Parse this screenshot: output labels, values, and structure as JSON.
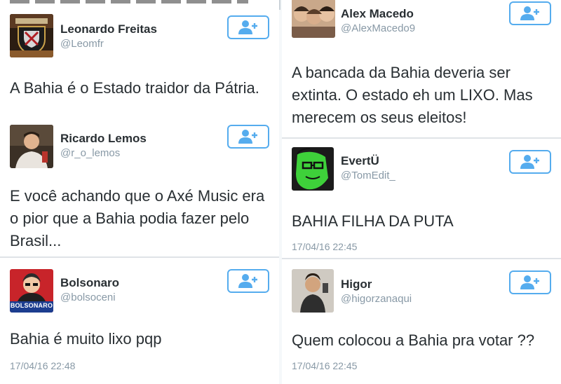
{
  "colors": {
    "accent": "#55acee",
    "text": "#292f33",
    "muted": "#8899a6",
    "divider": "#dfe3e7"
  },
  "icons": {
    "follow": "add-user-icon"
  },
  "left_column": {
    "tweets": [
      {
        "name": "Leonardo Freitas",
        "handle": "@Leomfr",
        "text": "A Bahia é o Estado traidor da Pátria.",
        "time": ""
      },
      {
        "name": "Ricardo Lemos",
        "handle": "@r_o_lemos",
        "text": "E você achando que o Axé Music era o pior que a Bahia podia fazer pelo Brasil...",
        "time": ""
      },
      {
        "name": "Bolsonaro",
        "handle": "@bolsoceni",
        "avatar_label": "BOLSONARO",
        "text": "Bahia é muito lixo pqp",
        "time": "17/04/16 22:48"
      }
    ]
  },
  "right_column": {
    "tweets": [
      {
        "name": "Alex Macedo",
        "handle": "@AlexMacedo9",
        "text": "A bancada da Bahia deveria ser extinta. O estado eh um LIXO. Mas merecem os seus eleitos!",
        "time": ""
      },
      {
        "name": "EvertÜ",
        "handle": "@TomEdit_",
        "text": "BAHIA FILHA DA PUTA",
        "time": "17/04/16 22:45"
      },
      {
        "name": "Higor",
        "handle": "@higorzanaqui",
        "text": "Quem colocou a Bahia pra votar ??",
        "time": "17/04/16 22:45"
      }
    ]
  }
}
